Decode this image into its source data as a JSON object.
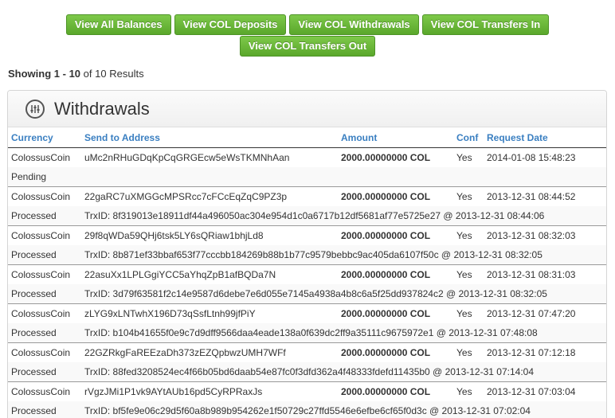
{
  "buttons": {
    "row1": [
      "View All Balances",
      "View COL Deposits",
      "View COL Withdrawals",
      "View COL Transfers In"
    ],
    "row2": [
      "View COL Transfers Out"
    ]
  },
  "results": {
    "prefix": "Showing",
    "range": "1 - 10",
    "middle": "of",
    "total": "10",
    "suffix": "Results"
  },
  "panel": {
    "title": "Withdrawals",
    "icon": "sliders-icon"
  },
  "columns": [
    "Currency",
    "Send to Address",
    "Amount",
    "Conf",
    "Request Date"
  ],
  "rows": [
    {
      "currency": "ColossusCoin",
      "address": "uMc2nRHuGDqKpCqGRGEcw5eWsTKMNhAan",
      "amount": "2000.00000000 COL",
      "conf": "Yes",
      "date": "2014-01-08 15:48:23",
      "status": "Pending",
      "detail": ""
    },
    {
      "currency": "ColossusCoin",
      "address": "22gaRC7uXMGGcMPSRcc7cFCcEqZqC9PZ3p",
      "amount": "2000.00000000 COL",
      "conf": "Yes",
      "date": "2013-12-31 08:44:52",
      "status": "Processed",
      "detail": "TrxID: 8f319013e18911df44a496050ac304e954d1c0a6717b12df5681af77e5725e27 @ 2013-12-31 08:44:06"
    },
    {
      "currency": "ColossusCoin",
      "address": "29f8qWDa59QHj6tsk5LY6sQRiaw1bhjLd8",
      "amount": "2000.00000000 COL",
      "conf": "Yes",
      "date": "2013-12-31 08:32:03",
      "status": "Processed",
      "detail": "TrxID: 8b871ef33bbaf653f77cccbb184269b88b1b77c9579bebbc9ac405da6107f50c @ 2013-12-31 08:32:05"
    },
    {
      "currency": "ColossusCoin",
      "address": "22asuXx1LPLGgiYCC5aYhqZpB1afBQDa7N",
      "amount": "2000.00000000 COL",
      "conf": "Yes",
      "date": "2013-12-31 08:31:03",
      "status": "Processed",
      "detail": "TrxID: 3d79f63581f2c14e9587d6debe7e6d055e7145a4938a4b8c6a5f25dd937824c2 @ 2013-12-31 08:32:05"
    },
    {
      "currency": "ColossusCoin",
      "address": "zLYG9xLNTwhX196D73qSsfLtnh99jfPiY",
      "amount": "2000.00000000 COL",
      "conf": "Yes",
      "date": "2013-12-31 07:47:20",
      "status": "Processed",
      "detail": "TrxID: b104b41655f0e9c7d9dff9566daa4eade138a0f639dc2ff9a35111c9675972e1 @ 2013-12-31 07:48:08"
    },
    {
      "currency": "ColossusCoin",
      "address": "22GZRkgFaREEzaDh373zEZQpbwzUMH7WFf",
      "amount": "2000.00000000 COL",
      "conf": "Yes",
      "date": "2013-12-31 07:12:18",
      "status": "Processed",
      "detail": "TrxID: 88fed3208524ec4f66b05bd6daab54e87fc0f3dfd362a4f48333fdefd11435b0 @ 2013-12-31 07:14:04"
    },
    {
      "currency": "ColossusCoin",
      "address": "rVgzJMi1P1vk9AYtAUb16pd5CyRPRaxJs",
      "amount": "2000.00000000 COL",
      "conf": "Yes",
      "date": "2013-12-31 07:03:04",
      "status": "Processed",
      "detail": "TrxID: bf5fe9e06c29d5f60a8b989b954262e1f50729c27ffd5546e6efbe6cf65f0d3c @ 2013-12-31 07:02:04"
    }
  ]
}
